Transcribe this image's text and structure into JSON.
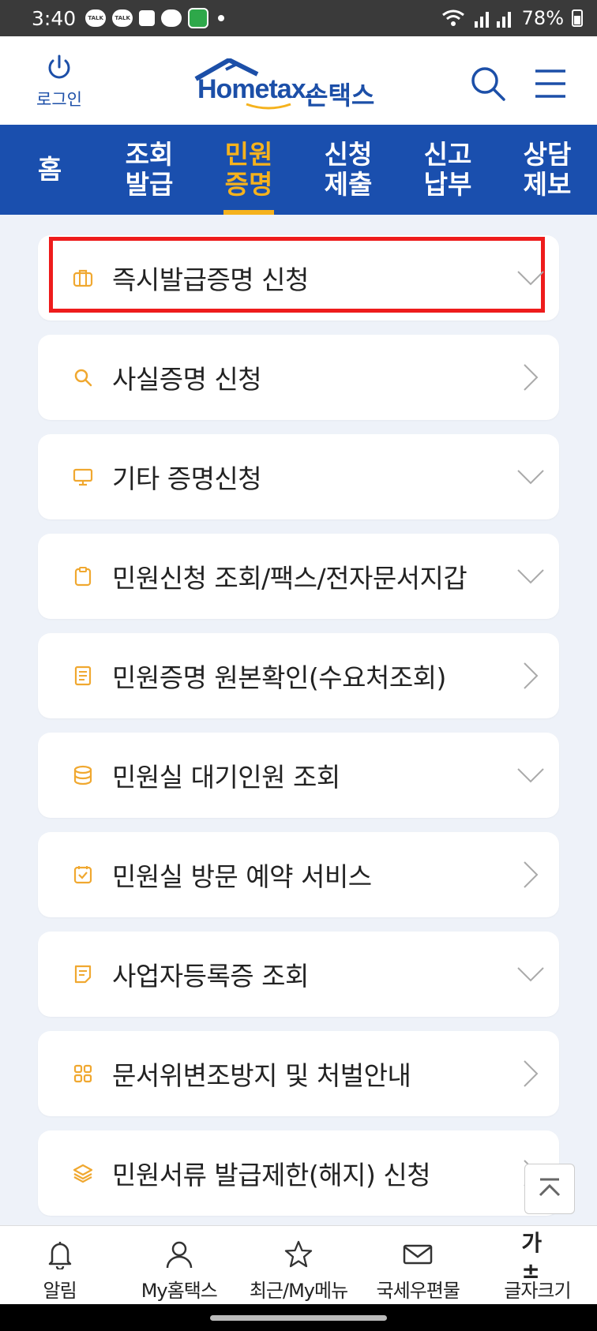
{
  "status": {
    "time": "3:40",
    "talk_label": "TALK",
    "battery": "78%"
  },
  "header": {
    "login_label": "로그인",
    "logo_text": "Hometax.",
    "logo_kor": "손택스"
  },
  "nav": {
    "tabs": [
      {
        "label": "홈"
      },
      {
        "label": "조회\n발급"
      },
      {
        "label": "민원\n증명"
      },
      {
        "label": "신청\n제출"
      },
      {
        "label": "신고\n납부"
      },
      {
        "label": "상담\n제보"
      }
    ],
    "active_index": 2
  },
  "menu": {
    "items": [
      {
        "label": "즉시발급증명 신청",
        "icon": "briefcase-icon",
        "arrow": "chevron-down"
      },
      {
        "label": "사실증명 신청",
        "icon": "search-icon",
        "arrow": "chevron-right"
      },
      {
        "label": "기타 증명신청",
        "icon": "monitor-icon",
        "arrow": "chevron-down"
      },
      {
        "label": "민원신청 조회/팩스/전자문서지갑",
        "icon": "clipboard-icon",
        "arrow": "chevron-down"
      },
      {
        "label": "민원증명 원본확인(수요처조회)",
        "icon": "document-icon",
        "arrow": "chevron-right"
      },
      {
        "label": "민원실 대기인원 조회",
        "icon": "database-icon",
        "arrow": "chevron-down"
      },
      {
        "label": "민원실 방문 예약 서비스",
        "icon": "calendar-check-icon",
        "arrow": "chevron-right"
      },
      {
        "label": "사업자등록증 조회",
        "icon": "note-icon",
        "arrow": "chevron-down"
      },
      {
        "label": "문서위변조방지 및 처벌안내",
        "icon": "grid-icon",
        "arrow": "chevron-right"
      },
      {
        "label": "민원서류 발급제한(해지) 신청",
        "icon": "layers-icon",
        "arrow": "chevron-right"
      }
    ]
  },
  "bottom": {
    "items": [
      {
        "label": "알림",
        "icon": "bell-icon"
      },
      {
        "label": "My홈택스",
        "icon": "person-icon"
      },
      {
        "label": "최근/My메뉴",
        "icon": "star-icon"
      },
      {
        "label": "국세우편물",
        "icon": "mail-icon"
      },
      {
        "label": "글자크기",
        "icon": "font-size-icon",
        "glyph": "가±"
      }
    ]
  },
  "colors": {
    "brand_blue": "#1a4fae",
    "accent_orange": "#f5b21d",
    "highlight_red": "#ee1c1c",
    "background": "#eef2f9"
  }
}
